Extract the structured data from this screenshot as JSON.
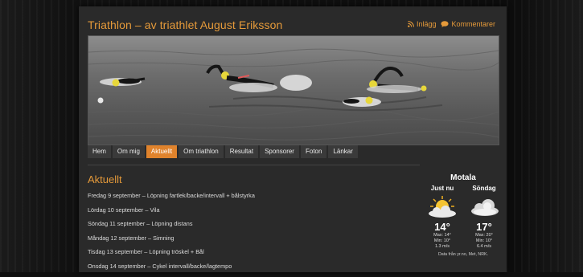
{
  "site": {
    "title": "Triathlon – av triathlet August Eriksson",
    "links": [
      {
        "label": "Inlägg",
        "icon": "rss-icon"
      },
      {
        "label": "Kommentarer",
        "icon": "comment-bubble-icon"
      }
    ]
  },
  "colors": {
    "accent": "#e59a3a",
    "active_tab": "#e0832c",
    "panel": "#2a2a2a"
  },
  "nav": {
    "items": [
      "Hem",
      "Om mig",
      "Aktuellt",
      "Om triathlon",
      "Resultat",
      "Sponsorer",
      "Foton",
      "Länkar"
    ],
    "active": "Aktuellt"
  },
  "main": {
    "title": "Aktuellt",
    "posts": [
      "Fredag 9  september – Löpning fartlek/backe/intervall + bålstyrka",
      "Lördag 10 september – Vila",
      "Söndag 11 september – Löpning distans",
      "Måndag 12 september – Simning",
      "Tisdag 13 september – Löpning tröskel + Bål",
      "Onsdag 14 september – Cykel intervall/backe/lagtempo"
    ]
  },
  "weather": {
    "city": "Motala",
    "days": [
      {
        "label": "Just nu",
        "icon": "sun-cloud-icon",
        "temp": "14°",
        "max": "Max: 14°",
        "min": "Min: 10°",
        "wind": "1.3 m/s"
      },
      {
        "label": "Söndag",
        "icon": "cloud-icon",
        "temp": "17°",
        "max": "Max: 20°",
        "min": "Min: 10°",
        "wind": "6.4 m/s"
      }
    ],
    "source": "Data från yr.no, Met, NRK."
  }
}
